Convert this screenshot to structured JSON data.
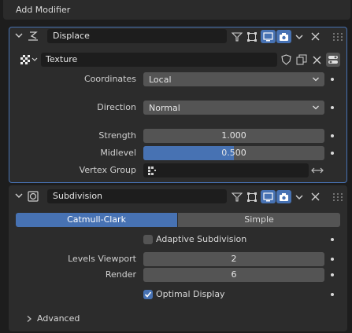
{
  "header": {
    "add_modifier_label": "Add Modifier"
  },
  "displace": {
    "name": "Displace",
    "texture_label": "Texture",
    "coordinates_label": "Coordinates",
    "coordinates_value": "Local",
    "direction_label": "Direction",
    "direction_value": "Normal",
    "strength_label": "Strength",
    "strength_value": "1.000",
    "midlevel_label": "Midlevel",
    "midlevel_value": "0.500",
    "midlevel_fraction": 0.5,
    "vertex_group_label": "Vertex Group",
    "vertex_group_value": ""
  },
  "subdivision": {
    "name": "Subdivision",
    "tab_catmull": "Catmull-Clark",
    "tab_simple": "Simple",
    "adaptive_label": "Adaptive Subdivision",
    "adaptive_checked": false,
    "levels_viewport_label": "Levels Viewport",
    "levels_viewport_value": "2",
    "render_label": "Render",
    "render_value": "6",
    "optimal_display_label": "Optimal Display",
    "optimal_display_checked": true,
    "advanced_label": "Advanced"
  },
  "colors": {
    "accent_blue": "#4772b3",
    "active_outline": "#4772b3",
    "panel": "#303030",
    "field": "#545454"
  }
}
